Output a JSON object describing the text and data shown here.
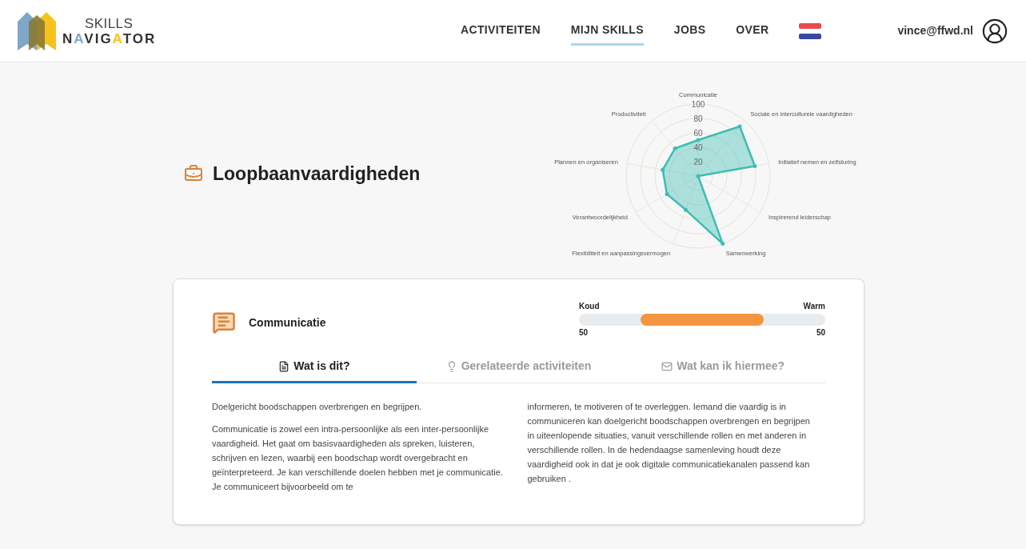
{
  "header": {
    "logo": {
      "top": "SKILLS",
      "bottom": "NAVIGATOR"
    },
    "nav": [
      {
        "label": "ACTIVITEITEN",
        "selected": false
      },
      {
        "label": "MIJN SKILLS",
        "selected": true
      },
      {
        "label": "JOBS",
        "selected": false
      },
      {
        "label": "OVER",
        "selected": false
      }
    ],
    "user": "vince@ffwd.nl"
  },
  "page_title": "Loopbaanvaardigheden",
  "radar_chart": {
    "top_axis": "Communicatie",
    "left_axes": [
      "Productiviteit",
      "Plannen en organiseren",
      "Verantwoordelijkheid",
      "Flexibiliteit en aanpassingsvermogen"
    ],
    "right_axes": [
      "Sociale en interculturele vaardigheden",
      "Initiatief nemen en zelfsturing",
      "Inspirerend leiderschap",
      "Samenwerking"
    ],
    "ticks": [
      "100",
      "80",
      "60",
      "40",
      "20"
    ]
  },
  "skill_card": {
    "name": "Communicatie",
    "scale": {
      "left": {
        "label": "Koud",
        "value": "50",
        "level": 0.5
      },
      "right": {
        "label": "Warm",
        "value": "50",
        "level": 0.5
      }
    },
    "tabs": [
      {
        "label": "Wat is dit?",
        "kind": "document",
        "selected": true
      },
      {
        "label": "Gerelateerde activiteiten",
        "kind": "lightbulb",
        "selected": false
      },
      {
        "label": "Wat kan ik hiermee?",
        "kind": "mail",
        "selected": false
      }
    ],
    "columns": [
      [
        "Doelgericht boodschappen overbrengen en begrijpen.",
        "Communicatie is zowel een intra-persoonlijke als een inter-persoonlijke vaardigheid. Het gaat om basisvaardigheden als spreken, luisteren, schrijven en lezen, waarbij een boodschap wordt overgebracht en geïnterpreteerd. Je kan verschillende doelen hebben met je communicatie. Je communiceert bijvoorbeeld om te"
      ],
      [
        "informeren, te motiveren of te overleggen. Iemand die vaardig is in communiceren kan doelgericht boodschappen overbrengen en begrijpen in uiteenlopende situaties, vanuit verschillende rollen en met anderen in verschillende rollen. In de hedendaagse samenleving houdt deze vaardigheid ook in dat je ook digitale communicatiekanalen passend kan gebruiken ."
      ]
    ]
  }
}
